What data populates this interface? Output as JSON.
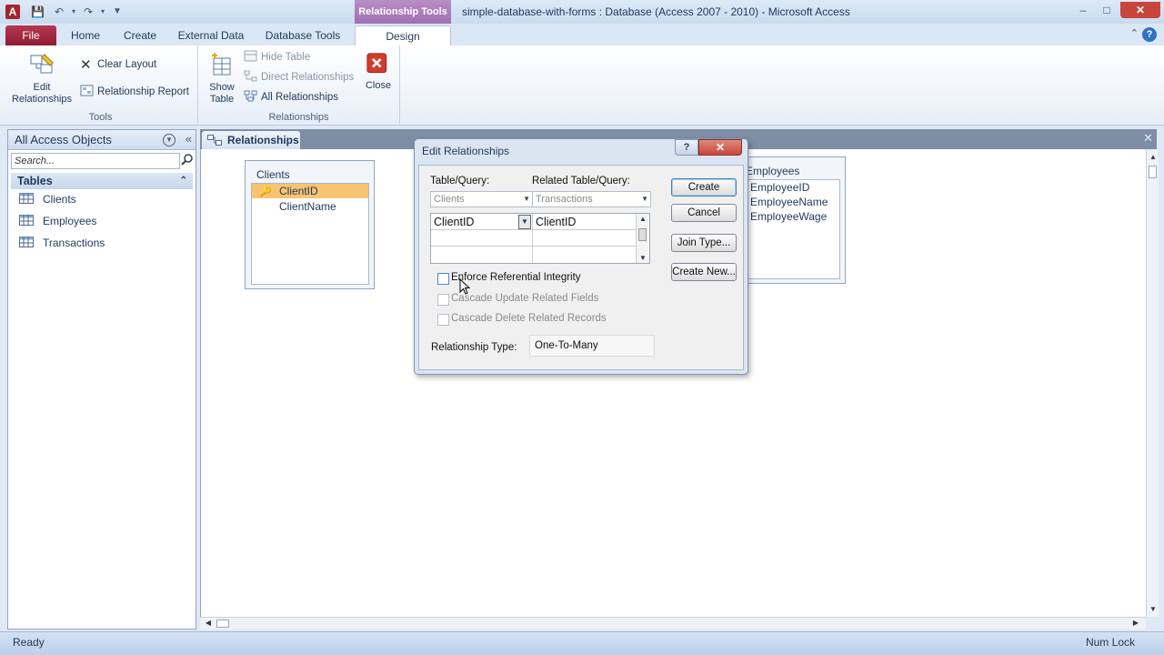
{
  "titlebar": {
    "context_tab": "Relationship Tools",
    "title": "simple-database-with-forms : Database (Access 2007 - 2010)  -  Microsoft Access",
    "minimize": "–",
    "maximize": "□",
    "close": "✕"
  },
  "tabs": {
    "file": "File",
    "home": "Home",
    "create": "Create",
    "external": "External Data",
    "dbtools": "Database Tools",
    "design": "Design"
  },
  "ribbon": {
    "tools": {
      "label": "Tools",
      "edit_relationships": "Edit Relationships",
      "clear_layout": "Clear Layout",
      "relationship_report": "Relationship Report"
    },
    "relationships": {
      "label": "Relationships",
      "show_table": "Show Table",
      "hide_table": "Hide Table",
      "direct_relationships": "Direct Relationships",
      "all_relationships": "All Relationships",
      "close": "Close"
    }
  },
  "navpane": {
    "title": "All Access Objects",
    "search_placeholder": "Search...",
    "group": "Tables",
    "items": [
      "Clients",
      "Employees",
      "Transactions"
    ]
  },
  "document": {
    "tab_label": "Relationships",
    "tables": {
      "clients": {
        "title": "Clients",
        "fields": [
          "ClientID",
          "ClientName"
        ]
      },
      "employees": {
        "title": "Employees",
        "fields": [
          "EmployeeID",
          "EmployeeName",
          "EmployeeWage"
        ]
      }
    }
  },
  "dialog": {
    "title": "Edit Relationships",
    "table_query_label": "Table/Query:",
    "related_label": "Related Table/Query:",
    "table_query_value": "Clients",
    "related_value": "Transactions",
    "grid": {
      "left_field": "ClientID",
      "right_field": "ClientID"
    },
    "enforce": "Enforce Referential Integrity",
    "cascade_update": "Cascade Update Related Fields",
    "cascade_delete": "Cascade Delete Related Records",
    "reltype_label": "Relationship Type:",
    "reltype_value": "One-To-Many",
    "buttons": {
      "create": "Create",
      "cancel": "Cancel",
      "join_type": "Join Type...",
      "create_new": "Create New..."
    }
  },
  "statusbar": {
    "left": "Ready",
    "right": "Num Lock"
  }
}
